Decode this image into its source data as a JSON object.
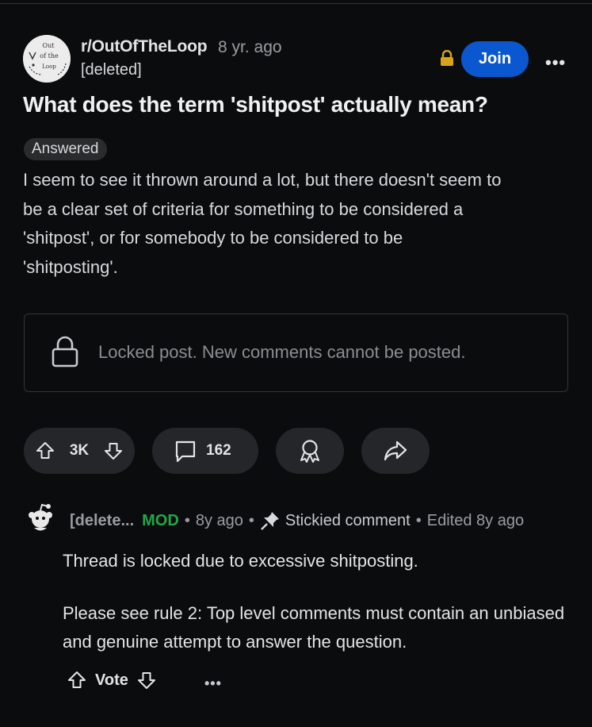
{
  "post": {
    "subreddit": "r/OutOfTheLoop",
    "age": "8 yr. ago",
    "author": "[deleted]",
    "join_label": "Join",
    "more_label": "•••",
    "title": "What does the term 'shitpost' actually mean?",
    "flair": "Answered",
    "body_lines": [
      "I seem to see it thrown around a lot, but there doesn't seem to",
      "be a clear set of criteria for something to be considered a",
      "'shitpost', or for somebody to be considered to be",
      "'shitposting'."
    ],
    "locked_message": "Locked post. New comments cannot be posted.",
    "score": "3K",
    "comment_count": "162",
    "avatar_text": [
      "Out",
      "of the",
      "Loop"
    ]
  },
  "comment": {
    "author": "[delete...",
    "mod_badge": "MOD",
    "dot": "•",
    "age": "8y ago",
    "stickied": "Stickied comment",
    "edited": "Edited 8y ago",
    "paragraph1": "Thread is locked due to excessive shitposting.",
    "paragraph2": "Please see rule 2: Top level comments must contain an unbiased and genuine attempt to answer the question.",
    "vote_label": "Vote",
    "more_label": "•••"
  },
  "icons": {
    "lock": "lock-icon",
    "upvote": "upvote-icon",
    "downvote": "downvote-icon",
    "comment": "comment-icon",
    "award": "award-icon",
    "share": "share-icon",
    "pin": "pin-icon"
  },
  "colors": {
    "background": "#0b0c0e",
    "join_button": "#0a57d0",
    "mod_badge": "#22a649",
    "lock_icon_gold": "#d9a21b",
    "pill": "#24262a"
  }
}
